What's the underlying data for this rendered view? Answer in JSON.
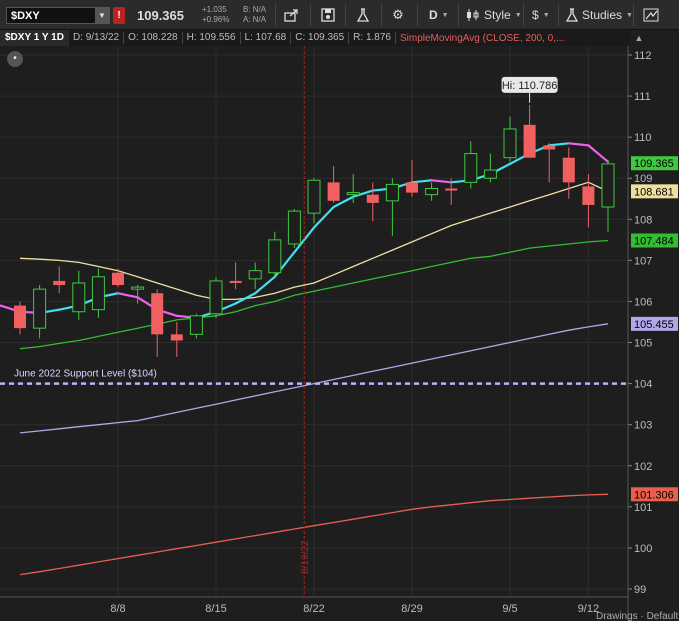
{
  "toolbar": {
    "symbol": "$DXY",
    "alert_glyph": "!",
    "last_price": "109.365",
    "net_change": "+1.035",
    "pct_change": "+0.96%",
    "bid": "B: N/A",
    "ask": "A: N/A",
    "aggregation": "D",
    "style_label": "Style",
    "studies_label": "Studies"
  },
  "infobar": {
    "symbol_period": "$DXY 1 Y 1D",
    "date": "D: 9/13/22",
    "open": "O: 108.228",
    "high": "H: 109.556",
    "low": "L: 107.68",
    "close": "C: 109.365",
    "range": "R: 1.876",
    "study": "SimpleMovingAvg (CLOSE, 200, 0,..."
  },
  "footer": {
    "text": "Drawings · Default"
  },
  "colors": {
    "background": "#1e1e1e",
    "up": "#3fc93f",
    "down": "#f06060",
    "sma20": "#f0e0a0",
    "sma50": "#33bb33",
    "sma100": "#b0a8e8",
    "sma200": "#e8604c",
    "sma9_up": "#40e0f0",
    "sma9_down": "#f060f0",
    "support": "#b8b4ff",
    "marker": "#b02020"
  },
  "chart_data": {
    "type": "candlestick",
    "ylim": [
      98.8,
      112.3
    ],
    "yticks": [
      99,
      100,
      101,
      102,
      103,
      104,
      105,
      106,
      107,
      108,
      109,
      110,
      111,
      112
    ],
    "xticks": [
      {
        "label": "8/8",
        "index": 5
      },
      {
        "label": "8/15",
        "index": 10
      },
      {
        "label": "8/22",
        "index": 15
      },
      {
        "label": "8/29",
        "index": 20
      },
      {
        "label": "9/5",
        "index": 25
      },
      {
        "label": "9/12",
        "index": 29
      }
    ],
    "candles": [
      {
        "date": "8/1",
        "o": 105.9,
        "h": 106.0,
        "l": 105.2,
        "c": 105.35
      },
      {
        "date": "8/2",
        "o": 105.35,
        "h": 106.4,
        "l": 105.1,
        "c": 106.3
      },
      {
        "date": "8/3",
        "o": 106.5,
        "h": 106.85,
        "l": 106.2,
        "c": 106.4
      },
      {
        "date": "8/4",
        "o": 105.75,
        "h": 106.75,
        "l": 105.55,
        "c": 106.45
      },
      {
        "date": "8/5",
        "o": 105.8,
        "h": 106.8,
        "l": 105.6,
        "c": 106.6
      },
      {
        "date": "8/8",
        "o": 106.7,
        "h": 106.8,
        "l": 106.35,
        "c": 106.4
      },
      {
        "date": "8/9",
        "o": 106.3,
        "h": 106.4,
        "l": 105.95,
        "c": 106.35
      },
      {
        "date": "8/10",
        "o": 106.2,
        "h": 106.3,
        "l": 104.65,
        "c": 105.2
      },
      {
        "date": "8/11",
        "o": 105.2,
        "h": 105.5,
        "l": 104.65,
        "c": 105.05
      },
      {
        "date": "8/12",
        "o": 105.2,
        "h": 105.7,
        "l": 105.1,
        "c": 105.65
      },
      {
        "date": "8/15",
        "o": 105.7,
        "h": 106.6,
        "l": 105.6,
        "c": 106.5
      },
      {
        "date": "8/16",
        "o": 106.5,
        "h": 106.95,
        "l": 106.3,
        "c": 106.45
      },
      {
        "date": "8/17",
        "o": 106.55,
        "h": 106.95,
        "l": 106.3,
        "c": 106.75
      },
      {
        "date": "8/18",
        "o": 106.7,
        "h": 107.7,
        "l": 106.6,
        "c": 107.5
      },
      {
        "date": "8/19",
        "o": 107.4,
        "h": 108.25,
        "l": 107.3,
        "c": 108.2
      },
      {
        "date": "8/22",
        "o": 108.15,
        "h": 109.0,
        "l": 107.9,
        "c": 108.95
      },
      {
        "date": "8/23",
        "o": 108.9,
        "h": 109.3,
        "l": 108.4,
        "c": 108.45
      },
      {
        "date": "8/24",
        "o": 108.6,
        "h": 109.1,
        "l": 108.4,
        "c": 108.65
      },
      {
        "date": "8/25",
        "o": 108.6,
        "h": 108.9,
        "l": 107.95,
        "c": 108.4
      },
      {
        "date": "8/26",
        "o": 108.45,
        "h": 109.0,
        "l": 107.6,
        "c": 108.85
      },
      {
        "date": "8/29",
        "o": 108.9,
        "h": 109.45,
        "l": 108.55,
        "c": 108.65
      },
      {
        "date": "8/30",
        "o": 108.6,
        "h": 108.9,
        "l": 108.45,
        "c": 108.75
      },
      {
        "date": "8/31",
        "o": 108.75,
        "h": 109.0,
        "l": 108.35,
        "c": 108.7
      },
      {
        "date": "9/1",
        "o": 108.9,
        "h": 109.9,
        "l": 108.75,
        "c": 109.6
      },
      {
        "date": "9/2",
        "o": 109.0,
        "h": 109.6,
        "l": 108.9,
        "c": 109.2
      },
      {
        "date": "9/5",
        "o": 109.5,
        "h": 110.5,
        "l": 109.4,
        "c": 110.2
      },
      {
        "date": "9/6",
        "o": 110.3,
        "h": 110.786,
        "l": 109.5,
        "c": 109.5
      },
      {
        "date": "9/7",
        "o": 109.8,
        "h": 109.85,
        "l": 108.9,
        "c": 109.7
      },
      {
        "date": "9/8",
        "o": 109.5,
        "h": 109.75,
        "l": 108.5,
        "c": 108.9
      },
      {
        "date": "9/9",
        "o": 108.8,
        "h": 109.1,
        "l": 107.8,
        "c": 108.35
      },
      {
        "date": "9/12",
        "o": 108.3,
        "h": 109.45,
        "l": 107.7,
        "c": 109.35
      }
    ],
    "sma9": [
      105.9,
      105.75,
      105.72,
      105.8,
      105.9,
      106.1,
      106.2,
      106.1,
      105.8,
      105.65,
      105.6,
      105.75,
      105.95,
      106.2,
      106.6,
      107.2,
      107.8,
      108.3,
      108.55,
      108.7,
      108.75,
      108.9,
      108.95,
      108.9,
      108.95,
      109.1,
      109.35,
      109.6,
      109.8,
      109.85,
      109.8,
      109.4
    ],
    "sma20": [
      107.05,
      107.03,
      107.0,
      106.95,
      106.85,
      106.75,
      106.6,
      106.45,
      106.3,
      106.15,
      106.05,
      106.05,
      106.1,
      106.2,
      106.35,
      106.45,
      106.65,
      106.85,
      107.05,
      107.25,
      107.45,
      107.65,
      107.85,
      108.0,
      108.15,
      108.3,
      108.45,
      108.6,
      108.75,
      108.9,
      108.68
    ],
    "sma50": [
      104.85,
      104.9,
      104.98,
      105.05,
      105.15,
      105.25,
      105.35,
      105.45,
      105.55,
      105.6,
      105.65,
      105.75,
      105.9,
      106.0,
      106.15,
      106.25,
      106.35,
      106.45,
      106.55,
      106.65,
      106.75,
      106.85,
      106.95,
      107.05,
      107.1,
      107.2,
      107.3,
      107.35,
      107.4,
      107.45,
      107.484
    ],
    "sma100": [
      102.8,
      102.85,
      102.9,
      102.95,
      103.0,
      103.05,
      103.1,
      103.2,
      103.3,
      103.4,
      103.5,
      103.6,
      103.7,
      103.8,
      103.9,
      104.0,
      104.1,
      104.2,
      104.3,
      104.4,
      104.5,
      104.6,
      104.7,
      104.8,
      104.9,
      105.0,
      105.1,
      105.2,
      105.3,
      105.38,
      105.455
    ],
    "sma200": [
      99.35,
      99.42,
      99.5,
      99.58,
      99.66,
      99.74,
      99.82,
      99.9,
      99.98,
      100.06,
      100.14,
      100.22,
      100.3,
      100.38,
      100.46,
      100.54,
      100.62,
      100.7,
      100.78,
      100.86,
      100.94,
      101.0,
      101.05,
      101.1,
      101.15,
      101.18,
      101.21,
      101.24,
      101.27,
      101.29,
      101.306
    ],
    "support": {
      "level": 104.0,
      "label": "June 2022 Support Level ($104)"
    },
    "high_label": "Hi: 110.786",
    "high_value": 110.786,
    "high_index": 26,
    "marker": {
      "index": 14,
      "label": "8/19/22"
    },
    "price_badges": [
      {
        "value": 109.365,
        "label": "109.365",
        "bg": "#3fc93f",
        "fg": "#000"
      },
      {
        "value": 108.681,
        "label": "108.681",
        "bg": "#f0e0a0",
        "fg": "#000"
      },
      {
        "value": 107.484,
        "label": "107.484",
        "bg": "#33bb33",
        "fg": "#000"
      },
      {
        "value": 105.455,
        "label": "105.455",
        "bg": "#b0a8e8",
        "fg": "#000"
      },
      {
        "value": 101.306,
        "label": "101.306",
        "bg": "#e8604c",
        "fg": "#000"
      }
    ]
  }
}
